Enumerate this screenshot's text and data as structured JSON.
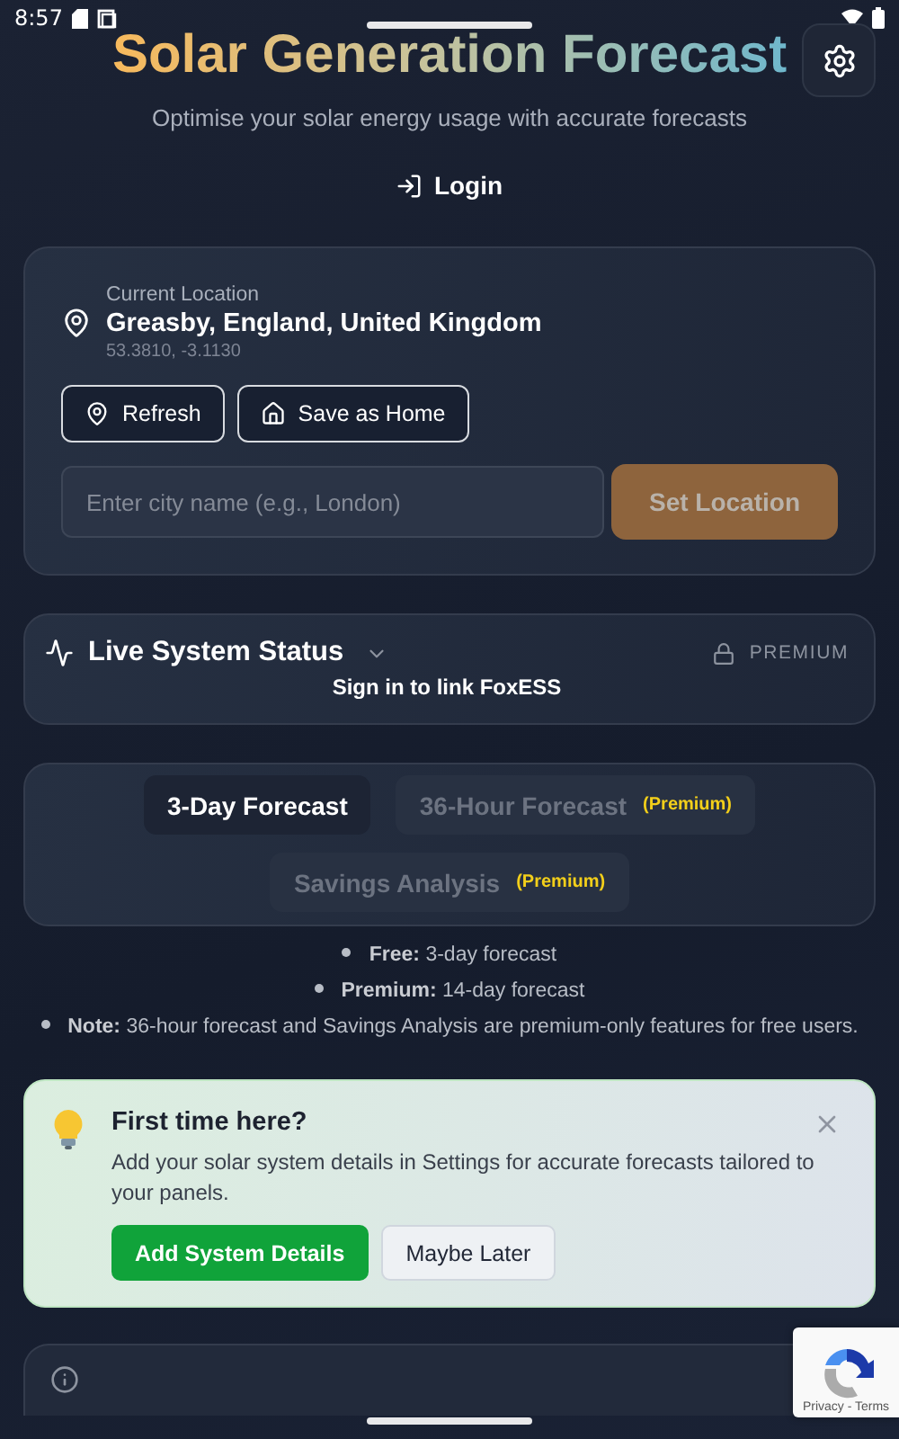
{
  "status_bar": {
    "time": "8:57"
  },
  "header": {
    "title": "Solar Generation Forecast",
    "subtitle": "Optimise your solar energy usage with accurate forecasts",
    "login": "Login"
  },
  "location": {
    "label": "Current Location",
    "name": "Greasby, England, United Kingdom",
    "coords": "53.3810, -3.1130",
    "buttons": [
      {
        "label": "Refresh",
        "kind": "pin"
      },
      {
        "label": "Save as Home",
        "kind": "home"
      }
    ],
    "input": {
      "placeholder": "Enter city name (e.g., London)"
    },
    "submit": "Set Location"
  },
  "live_status": {
    "title": "Live System Status",
    "expanded": false,
    "badge": "PREMIUM",
    "message": "Sign in to link FoxESS"
  },
  "tabs": [
    {
      "label": "3-Day Forecast",
      "selected": true,
      "disabled": false
    },
    {
      "label": "36-Hour Forecast",
      "badge": "(Premium)",
      "selected": false,
      "disabled": true
    },
    {
      "label": "Savings Analysis",
      "badge": "(Premium)",
      "selected": false,
      "disabled": true
    }
  ],
  "notes": [
    "**Free:** 3-day forecast",
    "**Premium:** 14-day forecast",
    "**Note:** 36-hour forecast and Savings Analysis are premium-only features for free users."
  ],
  "onboarding": {
    "title": "First time here?",
    "text": "Add your solar system details in Settings for accurate forecasts tailored to your panels.",
    "buttons": [
      {
        "label": "Add System Details",
        "kind": "primary"
      },
      {
        "label": "Maybe Later",
        "kind": "secondary"
      }
    ]
  },
  "recaptcha": {
    "text": "Privacy - Terms"
  }
}
